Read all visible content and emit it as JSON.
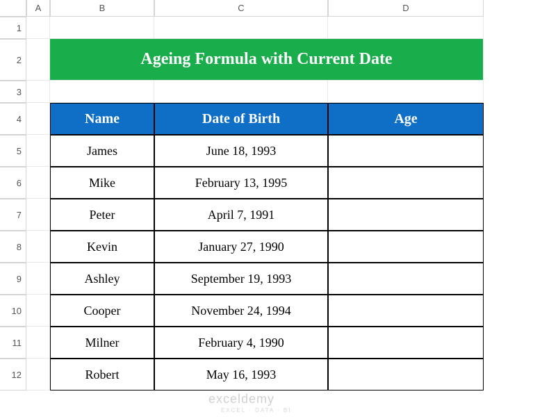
{
  "columns": [
    "A",
    "B",
    "C",
    "D"
  ],
  "rows": [
    "1",
    "2",
    "3",
    "4",
    "5",
    "6",
    "7",
    "8",
    "9",
    "10",
    "11",
    "12"
  ],
  "title": "Ageing Formula with Current Date",
  "headers": {
    "name": "Name",
    "dob": "Date of Birth",
    "age": "Age"
  },
  "data": [
    {
      "name": "James",
      "dob": "June 18, 1993",
      "age": ""
    },
    {
      "name": "Mike",
      "dob": "February 13, 1995",
      "age": ""
    },
    {
      "name": "Peter",
      "dob": "April 7, 1991",
      "age": ""
    },
    {
      "name": "Kevin",
      "dob": "January 27, 1990",
      "age": ""
    },
    {
      "name": "Ashley",
      "dob": "September 19, 1993",
      "age": ""
    },
    {
      "name": "Cooper",
      "dob": "November 24, 1994",
      "age": ""
    },
    {
      "name": "Milner",
      "dob": "February 4, 1990",
      "age": ""
    },
    {
      "name": "Robert",
      "dob": "May 16, 1993",
      "age": ""
    }
  ],
  "watermark": "exceldemy",
  "watermark_sub": "EXCEL · DATA · BI"
}
